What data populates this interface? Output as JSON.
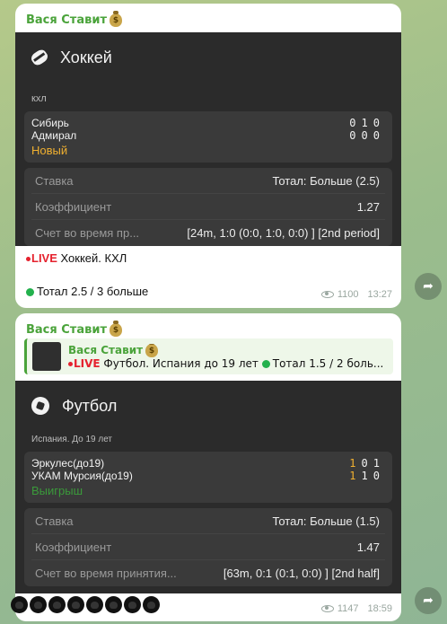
{
  "messages": [
    {
      "sender": "Вася Ставит",
      "sport": "Хоккей",
      "league": "кхл",
      "teams": [
        {
          "name": "Сибирь",
          "scores": [
            "0",
            "1",
            "0"
          ]
        },
        {
          "name": "Адмирал",
          "scores": [
            "0",
            "0",
            "0"
          ]
        }
      ],
      "status": "Новый",
      "details": [
        {
          "label": "Ставка",
          "value": "Тотал: Больше (2.5)"
        },
        {
          "label": "Коэффициент",
          "value": "1.27"
        },
        {
          "label": "Счет во время пр...",
          "value": "[24m, 1:0 (0:0, 1:0, 0:0) ] [2nd period]"
        }
      ],
      "caption_live": "LIVE",
      "caption_text": " Хоккей. КХЛ",
      "result_text": "Тотал 2.5 / 3 больше",
      "views": "1100",
      "time": "13:27"
    },
    {
      "sender": "Вася Ставит",
      "reply": {
        "name": "Вася Ставит",
        "live": "LIVE",
        "text": " Футбол. Испания до 19 лет ",
        "result": "Тотал 1.5 / 2 боль..."
      },
      "sport": "Футбол",
      "league": "Испания. До 19 лет",
      "teams": [
        {
          "name": "Эркулес(до19)",
          "scores": [
            "1",
            "0",
            "1"
          ]
        },
        {
          "name": "УКАМ Мурсия(до19)",
          "scores": [
            "1",
            "1",
            "0"
          ]
        }
      ],
      "status": "Выигрыш",
      "details": [
        {
          "label": "Ставка",
          "value": "Тотал: Больше (1.5)"
        },
        {
          "label": "Коэффициент",
          "value": "1.47"
        },
        {
          "label": "Счет во время принятия...",
          "value": "[63m, 0:1 (0:1, 0:0) ] [2nd half]"
        }
      ],
      "views": "1147",
      "time": "18:59",
      "reaction_count": 8
    }
  ],
  "colors": {
    "sender": "#4aa33a",
    "live": "#e5222e",
    "new_status": "#f0b030",
    "win_status": "#3a9a3a",
    "card_bg": "#2b2b2b"
  },
  "icons": {
    "hockey": "hockey-puck-icon",
    "football": "soccer-ball-icon",
    "money": "money-bag-icon",
    "views": "eye-icon",
    "share": "share-arrow-icon",
    "reaction": "paw-icon"
  }
}
